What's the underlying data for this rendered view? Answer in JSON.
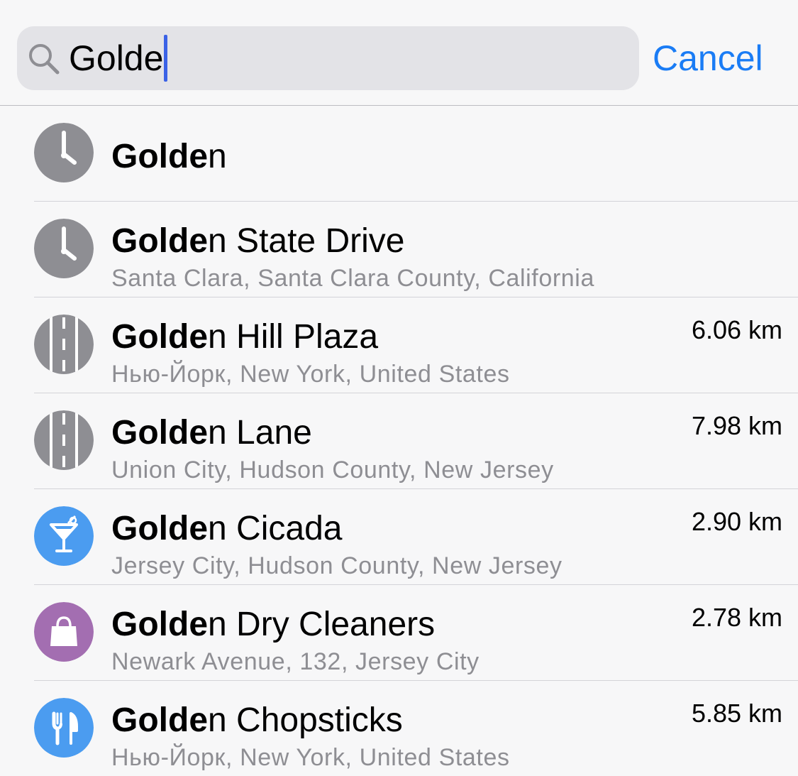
{
  "search": {
    "value": "Golde",
    "cancel_label": "Cancel"
  },
  "results": [
    {
      "icon": "clock-icon",
      "icon_color": "#8e8e93",
      "match": "Golde",
      "rest": "n",
      "subtitle": "",
      "distance": ""
    },
    {
      "icon": "clock-icon",
      "icon_color": "#8e8e93",
      "match": "Golde",
      "rest": "n State Drive",
      "subtitle": "Santa Clara, Santa Clara County, California",
      "distance": ""
    },
    {
      "icon": "road-icon",
      "icon_color": "#8e8e93",
      "match": "Golde",
      "rest": "n Hill Plaza",
      "subtitle": "Нью-Йорк, New York, United States",
      "distance": "6.06 km"
    },
    {
      "icon": "road-icon",
      "icon_color": "#8e8e93",
      "match": "Golde",
      "rest": "n Lane",
      "subtitle": "Union City, Hudson County, New Jersey",
      "distance": "7.98 km"
    },
    {
      "icon": "cocktail-icon",
      "icon_color": "#4b9cf0",
      "match": "Golde",
      "rest": "n Cicada",
      "subtitle": "Jersey City, Hudson County, New Jersey",
      "distance": "2.90 km"
    },
    {
      "icon": "shopping-bag-icon",
      "icon_color": "#a36eb1",
      "match": "Golde",
      "rest": "n Dry Cleaners",
      "subtitle": "Newark Avenue, 132, Jersey City",
      "distance": "2.78 km"
    },
    {
      "icon": "fork-knife-icon",
      "icon_color": "#4b9cf0",
      "match": "Golde",
      "rest": "n Chopsticks",
      "subtitle": "Нью-Йорк, New York, United States",
      "distance": "5.85 km"
    }
  ]
}
